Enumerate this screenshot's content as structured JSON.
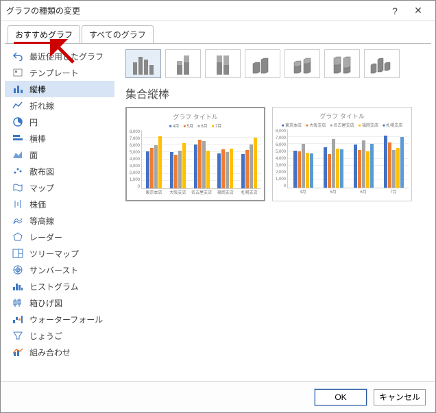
{
  "window": {
    "title": "グラフの種類の変更",
    "help": "?",
    "close": "✕"
  },
  "tabs": {
    "recommended": "おすすめグラフ",
    "all": "すべてのグラフ"
  },
  "sidebar": {
    "items": [
      {
        "icon": "undo",
        "label": "最近使用したグラフ"
      },
      {
        "icon": "template",
        "label": "テンプレート"
      },
      {
        "icon": "column",
        "label": "縦棒"
      },
      {
        "icon": "line",
        "label": "折れ線"
      },
      {
        "icon": "pie",
        "label": "円"
      },
      {
        "icon": "bar",
        "label": "横棒"
      },
      {
        "icon": "area",
        "label": "面"
      },
      {
        "icon": "scatter",
        "label": "散布図"
      },
      {
        "icon": "map",
        "label": "マップ"
      },
      {
        "icon": "stock",
        "label": "株価"
      },
      {
        "icon": "surface",
        "label": "等高線"
      },
      {
        "icon": "radar",
        "label": "レーダー"
      },
      {
        "icon": "treemap",
        "label": "ツリーマップ"
      },
      {
        "icon": "sunburst",
        "label": "サンバースト"
      },
      {
        "icon": "histogram",
        "label": "ヒストグラム"
      },
      {
        "icon": "boxwhisker",
        "label": "箱ひげ図"
      },
      {
        "icon": "waterfall",
        "label": "ウォーターフォール"
      },
      {
        "icon": "funnel",
        "label": "じょうご"
      },
      {
        "icon": "combo",
        "label": "組み合わせ"
      }
    ]
  },
  "content": {
    "type_title": "集合縦棒",
    "preview_title": "グラフ タイトル"
  },
  "footer": {
    "ok": "OK",
    "cancel": "キャンセル"
  },
  "chart_data": [
    {
      "type": "bar",
      "title": "グラフ タイトル",
      "ylim": [
        0,
        8000
      ],
      "yticks": [
        0,
        1000,
        2000,
        3000,
        4000,
        5000,
        6000,
        7000,
        8000
      ],
      "categories": [
        "東京本店",
        "大阪支店",
        "名古屋支店",
        "福岡支店",
        "札幌支店"
      ],
      "series": [
        {
          "name": "4月",
          "color": "#4472c4",
          "values": [
            5100,
            5000,
            6000,
            4800,
            4700
          ]
        },
        {
          "name": "5月",
          "color": "#ed7d31",
          "values": [
            5600,
            4600,
            6700,
            5400,
            5300
          ]
        },
        {
          "name": "6月",
          "color": "#a5a5a5",
          "values": [
            5900,
            5200,
            6500,
            5000,
            6000
          ]
        },
        {
          "name": "7月",
          "color": "#ffc000",
          "values": [
            7200,
            6200,
            5200,
            5500,
            7000
          ]
        }
      ],
      "legend_labels": [
        "4月",
        "5月",
        "6月",
        "7月"
      ],
      "xlabel": "",
      "ylabel": ""
    },
    {
      "type": "bar",
      "title": "グラフ タイトル",
      "ylim": [
        0,
        8000
      ],
      "yticks": [
        0,
        1000,
        2000,
        3000,
        4000,
        5000,
        6000,
        7000,
        8000
      ],
      "categories": [
        "4月",
        "5月",
        "6月",
        "7月"
      ],
      "series": [
        {
          "name": "東京本店",
          "color": "#4472c4",
          "values": [
            5100,
            5600,
            5900,
            7200
          ]
        },
        {
          "name": "大阪支店",
          "color": "#ed7d31",
          "values": [
            5000,
            4600,
            5200,
            6200
          ]
        },
        {
          "name": "名古屋支店",
          "color": "#a5a5a5",
          "values": [
            6000,
            6700,
            6500,
            5200
          ]
        },
        {
          "name": "福岡支店",
          "color": "#ffc000",
          "values": [
            4800,
            5400,
            5000,
            5500
          ]
        },
        {
          "name": "札幌支店",
          "color": "#5b9bd5",
          "values": [
            4700,
            5300,
            6000,
            7000
          ]
        }
      ],
      "legend_labels": [
        "東京本店",
        "大阪支店",
        "名古屋支店",
        "福岡支店",
        "札幌支店"
      ],
      "xlabel": "",
      "ylabel": ""
    }
  ]
}
